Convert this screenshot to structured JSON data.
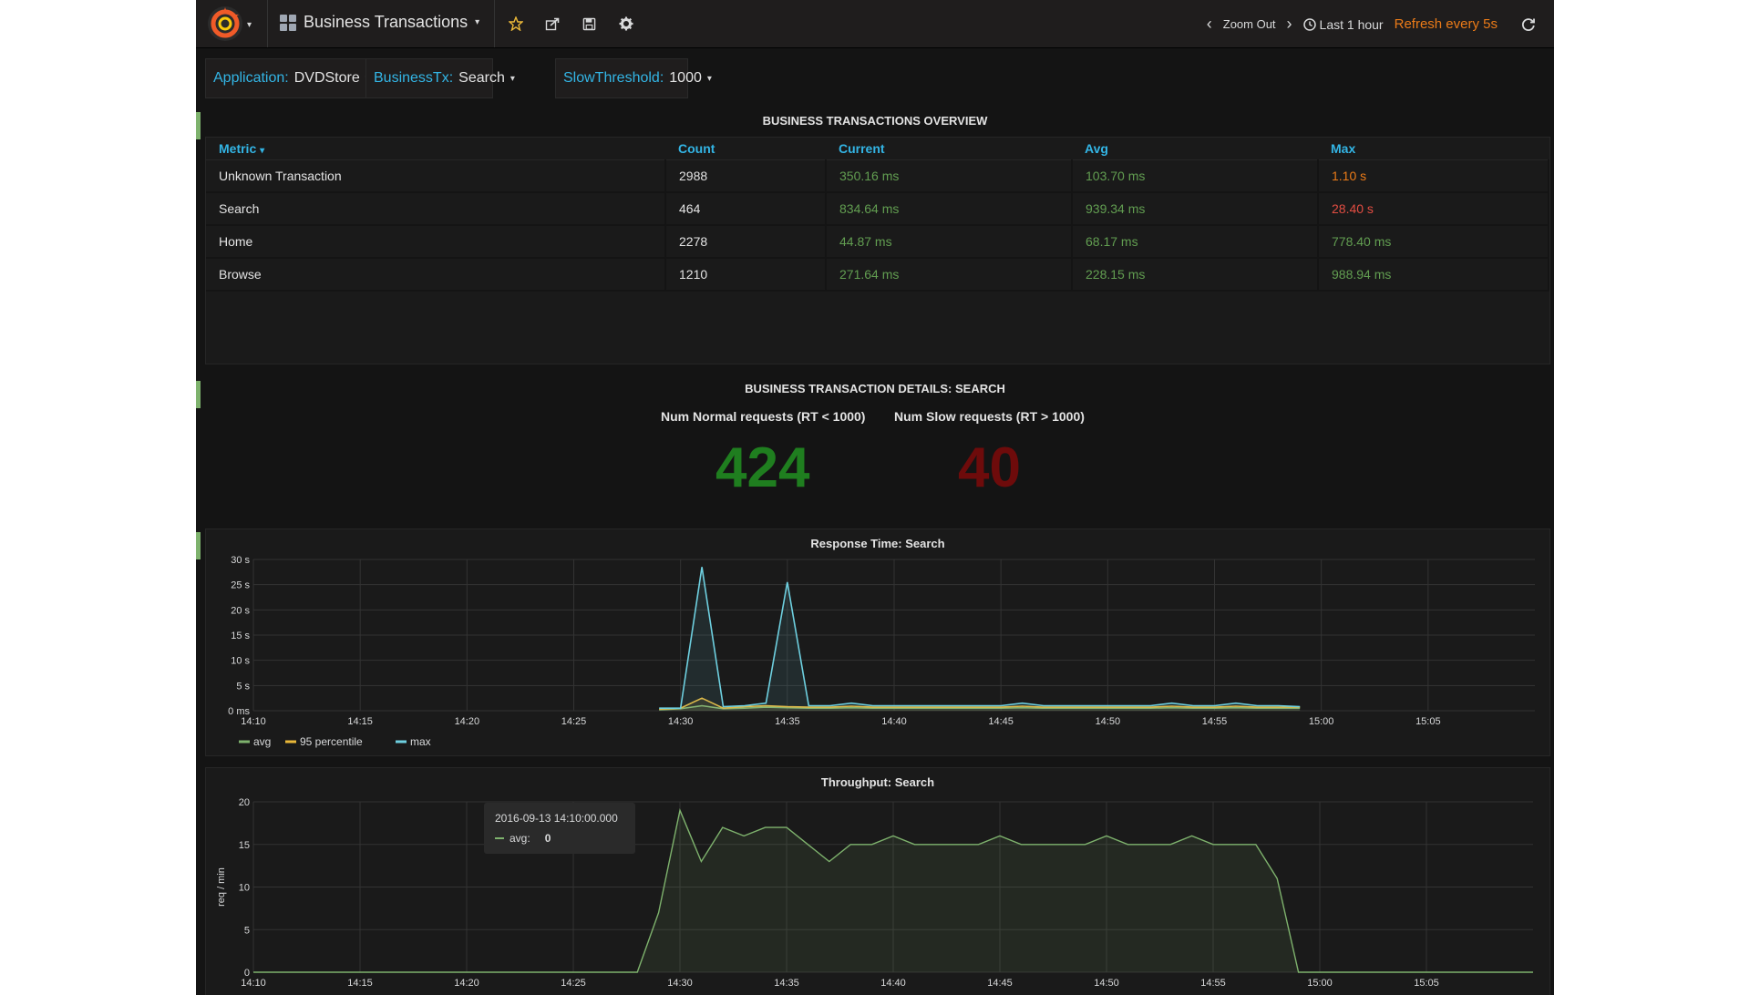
{
  "navbar": {
    "dashboard_title": "Business Transactions",
    "zoom_out": "Zoom Out",
    "time_range": "Last 1 hour",
    "refresh": "Refresh every 5s"
  },
  "variables": [
    {
      "label": "Application:",
      "value": "DVDStore"
    },
    {
      "label": "BusinessTx:",
      "value": "Search"
    },
    {
      "label": "SlowThreshold:",
      "value": "1000"
    }
  ],
  "overview": {
    "title": "BUSINESS TRANSACTIONS OVERVIEW",
    "columns": [
      "Metric",
      "Count",
      "Current",
      "Avg",
      "Max"
    ],
    "rows": [
      {
        "metric": "Unknown Transaction",
        "count": "2988",
        "current": "350.16 ms",
        "avg": "103.70 ms",
        "max": "1.10 s",
        "max_color": "orange"
      },
      {
        "metric": "Search",
        "count": "464",
        "current": "834.64 ms",
        "avg": "939.34 ms",
        "max": "28.40 s",
        "max_color": "red"
      },
      {
        "metric": "Home",
        "count": "2278",
        "current": "44.87 ms",
        "avg": "68.17 ms",
        "max": "778.40 ms",
        "max_color": "green"
      },
      {
        "metric": "Browse",
        "count": "1210",
        "current": "271.64 ms",
        "avg": "228.15 ms",
        "max": "988.94 ms",
        "max_color": "green"
      }
    ]
  },
  "details": {
    "title": "BUSINESS TRANSACTION DETAILS: SEARCH",
    "normal_label": "Num Normal requests (RT < 1000)",
    "normal_value": "424",
    "slow_label": "Num Slow requests (RT > 1000)",
    "slow_value": "40"
  },
  "colors": {
    "green": "#629e51",
    "orange": "#eb7b18",
    "red": "#e24d42",
    "blue": "#33b5e5",
    "stat_green": "#1f7e1f",
    "stat_red": "#6e0b0b"
  },
  "chart_data": [
    {
      "type": "line",
      "title": "Response Time: Search",
      "xlabel": "",
      "ylabel": "",
      "x_ticks": [
        "14:10",
        "14:15",
        "14:20",
        "14:25",
        "14:30",
        "14:35",
        "14:40",
        "14:45",
        "14:50",
        "14:55",
        "15:00",
        "15:05"
      ],
      "y_ticks": [
        "0 ms",
        "5 s",
        "10 s",
        "15 s",
        "20 s",
        "25 s",
        "30 s"
      ],
      "ylim": [
        0,
        30
      ],
      "x_range_minutes": [
        0,
        60
      ],
      "grid": true,
      "legend": "bottom-left",
      "series": [
        {
          "name": "avg",
          "color": "#7eb26d",
          "x": [
            19,
            20,
            21,
            22,
            23,
            24,
            25,
            26,
            27,
            28,
            29,
            30,
            31,
            32,
            33,
            34,
            35,
            36,
            37,
            38,
            39,
            40,
            41,
            42,
            43,
            44,
            45,
            46,
            47,
            48,
            49
          ],
          "values": [
            0.2,
            0.4,
            1.0,
            0.4,
            0.5,
            0.7,
            0.6,
            0.5,
            0.5,
            0.6,
            0.5,
            0.5,
            0.5,
            0.5,
            0.5,
            0.5,
            0.5,
            0.6,
            0.5,
            0.5,
            0.5,
            0.5,
            0.5,
            0.5,
            0.6,
            0.5,
            0.5,
            0.6,
            0.5,
            0.5,
            0.5
          ]
        },
        {
          "name": "95 percentile",
          "color": "#eab839",
          "x": [
            19,
            20,
            21,
            22,
            23,
            24,
            25,
            26,
            27,
            28,
            29,
            30,
            31,
            32,
            33,
            34,
            35,
            36,
            37,
            38,
            39,
            40,
            41,
            42,
            43,
            44,
            45,
            46,
            47,
            48,
            49
          ],
          "values": [
            0.3,
            0.5,
            2.5,
            0.5,
            0.8,
            1.0,
            0.8,
            0.7,
            0.7,
            0.9,
            0.7,
            0.7,
            0.7,
            0.7,
            0.7,
            0.7,
            0.7,
            0.9,
            0.7,
            0.7,
            0.7,
            0.7,
            0.7,
            0.7,
            0.9,
            0.7,
            0.7,
            0.9,
            0.7,
            0.7,
            0.7
          ]
        },
        {
          "name": "max",
          "color": "#6ed0e0",
          "x": [
            19,
            20,
            21,
            22,
            23,
            24,
            25,
            26,
            27,
            28,
            29,
            30,
            31,
            32,
            33,
            34,
            35,
            36,
            37,
            38,
            39,
            40,
            41,
            42,
            43,
            44,
            45,
            46,
            47,
            48,
            49
          ],
          "values": [
            0.5,
            0.5,
            28.5,
            0.8,
            1.0,
            1.5,
            25.5,
            1.0,
            1.0,
            1.5,
            1.0,
            1.0,
            1.0,
            1.0,
            1.0,
            1.0,
            1.0,
            1.5,
            1.0,
            1.0,
            1.0,
            1.0,
            1.0,
            1.0,
            1.5,
            1.0,
            1.0,
            1.5,
            1.0,
            1.0,
            0.8
          ]
        }
      ]
    },
    {
      "type": "area",
      "title": "Throughput: Search",
      "xlabel": "",
      "ylabel": "req / min",
      "x_ticks": [
        "14:10",
        "14:15",
        "14:20",
        "14:25",
        "14:30",
        "14:35",
        "14:40",
        "14:45",
        "14:50",
        "14:55",
        "15:00",
        "15:05"
      ],
      "y_ticks": [
        "0",
        "5",
        "10",
        "15",
        "20"
      ],
      "ylim": [
        0,
        20
      ],
      "x_range_minutes": [
        0,
        60
      ],
      "grid": true,
      "series": [
        {
          "name": "avg",
          "color": "#7eb26d",
          "x": [
            0,
            18,
            19,
            20,
            21,
            22,
            23,
            24,
            25,
            26,
            27,
            28,
            29,
            30,
            31,
            32,
            33,
            34,
            35,
            36,
            37,
            38,
            39,
            40,
            41,
            42,
            43,
            44,
            45,
            46,
            47,
            48,
            49,
            50,
            60
          ],
          "values": [
            0,
            0,
            7,
            19,
            13,
            17,
            16,
            17,
            17,
            15,
            13,
            15,
            15,
            16,
            15,
            15,
            15,
            15,
            16,
            15,
            15,
            15,
            15,
            16,
            15,
            15,
            15,
            16,
            15,
            15,
            15,
            11,
            0,
            0,
            0
          ]
        }
      ],
      "tooltip": {
        "time": "2016-09-13 14:10:00.000",
        "label": "avg:",
        "value": "0"
      }
    }
  ]
}
